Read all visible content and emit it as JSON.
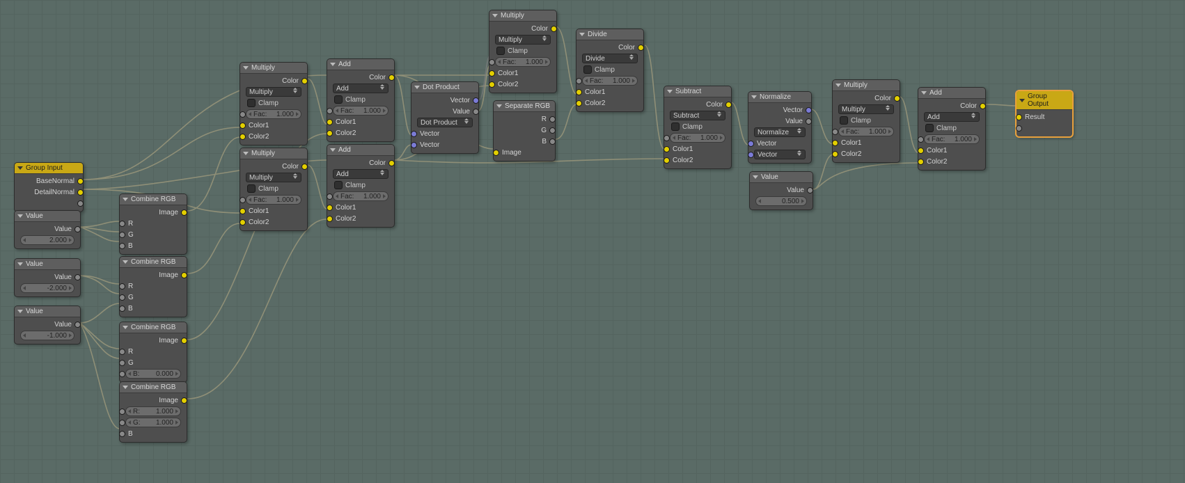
{
  "nodes": {
    "groupInput": {
      "title": "Group Input",
      "out1": "BaseNormal",
      "out2": "DetailNormal"
    },
    "value1": {
      "title": "Value",
      "out": "Value",
      "val": "2.000"
    },
    "value2": {
      "title": "Value",
      "out": "Value",
      "val": "-2.000"
    },
    "value3": {
      "title": "Value",
      "out": "Value",
      "val": "-1.000"
    },
    "combine1": {
      "title": "Combine RGB",
      "out": "Image",
      "r": "R",
      "g": "G",
      "b": "B"
    },
    "combine2": {
      "title": "Combine RGB",
      "out": "Image",
      "r": "R",
      "g": "G",
      "b": "B"
    },
    "combine3": {
      "title": "Combine RGB",
      "out": "Image",
      "r": "R",
      "g": "G",
      "b": "B",
      "bLabel": "B:",
      "bVal": "0.000"
    },
    "combine4": {
      "title": "Combine RGB",
      "out": "Image",
      "r": "R",
      "g": "G",
      "b": "B",
      "rLabel": "R:",
      "rVal": "1.000",
      "gLabel": "G:",
      "gVal": "1.000"
    },
    "mult1": {
      "title": "Multiply",
      "out": "Color",
      "mode": "Multiply",
      "clamp": "Clamp",
      "fac": "Fac:",
      "facVal": "1.000",
      "c1": "Color1",
      "c2": "Color2"
    },
    "mult2": {
      "title": "Multiply",
      "out": "Color",
      "mode": "Multiply",
      "clamp": "Clamp",
      "fac": "Fac:",
      "facVal": "1.000",
      "c1": "Color1",
      "c2": "Color2"
    },
    "add1": {
      "title": "Add",
      "out": "Color",
      "mode": "Add",
      "clamp": "Clamp",
      "fac": "Fac:",
      "facVal": "1.000",
      "c1": "Color1",
      "c2": "Color2"
    },
    "add2": {
      "title": "Add",
      "out": "Color",
      "mode": "Add",
      "clamp": "Clamp",
      "fac": "Fac:",
      "facVal": "1.000",
      "c1": "Color1",
      "c2": "Color2"
    },
    "dot": {
      "title": "Dot Product",
      "outVec": "Vector",
      "outVal": "Value",
      "mode": "Dot Product",
      "in1": "Vector",
      "in2": "Vector"
    },
    "mult3": {
      "title": "Multiply",
      "out": "Color",
      "mode": "Multiply",
      "clamp": "Clamp",
      "fac": "Fac:",
      "facVal": "1.000",
      "c1": "Color1",
      "c2": "Color2"
    },
    "sep": {
      "title": "Separate RGB",
      "r": "R",
      "g": "G",
      "b": "B",
      "in": "Image"
    },
    "div": {
      "title": "Divide",
      "out": "Color",
      "mode": "Divide",
      "clamp": "Clamp",
      "fac": "Fac:",
      "facVal": "1.000",
      "c1": "Color1",
      "c2": "Color2"
    },
    "sub": {
      "title": "Subtract",
      "out": "Color",
      "mode": "Subtract",
      "clamp": "Clamp",
      "fac": "Fac:",
      "facVal": "1.000",
      "c1": "Color1",
      "c2": "Color2"
    },
    "norm": {
      "title": "Normalize",
      "outVec": "Vector",
      "outVal": "Value",
      "mode": "Normalize",
      "in1": "Vector",
      "in2": "Vector"
    },
    "mult4": {
      "title": "Multiply",
      "out": "Color",
      "mode": "Multiply",
      "clamp": "Clamp",
      "fac": "Fac:",
      "facVal": "1.000",
      "c1": "Color1",
      "c2": "Color2"
    },
    "value4": {
      "title": "Value",
      "out": "Value",
      "val": "0.500"
    },
    "add3": {
      "title": "Add",
      "out": "Color",
      "mode": "Add",
      "clamp": "Clamp",
      "fac": "Fac:",
      "facVal": "1.000",
      "c1": "Color1",
      "c2": "Color2"
    },
    "groupOutput": {
      "title": "Group Output",
      "in": "Result"
    }
  }
}
